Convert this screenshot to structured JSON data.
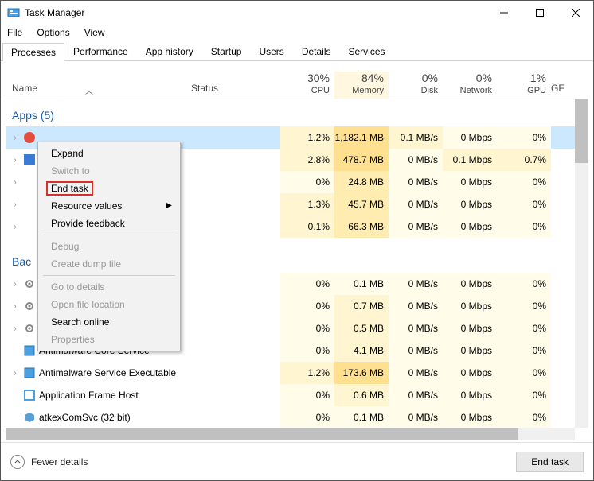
{
  "title": "Task Manager",
  "menubar": [
    "File",
    "Options",
    "View"
  ],
  "tabs": [
    "Processes",
    "Performance",
    "App history",
    "Startup",
    "Users",
    "Details",
    "Services"
  ],
  "active_tab": 0,
  "columns": {
    "name": "Name",
    "status": "Status",
    "metrics": [
      {
        "pct": "30%",
        "label": "CPU"
      },
      {
        "pct": "84%",
        "label": "Memory"
      },
      {
        "pct": "0%",
        "label": "Disk"
      },
      {
        "pct": "0%",
        "label": "Network"
      },
      {
        "pct": "1%",
        "label": "GPU"
      }
    ],
    "last": "GF"
  },
  "sections": [
    {
      "title": "Apps (5)"
    },
    {
      "title": "Bac"
    }
  ],
  "rows": [
    {
      "selected": true,
      "expander": true,
      "icon": "red",
      "name": "",
      "cells": [
        "1.2%",
        "1,182.1 MB",
        "0.1 MB/s",
        "0 Mbps",
        "0%"
      ],
      "shades": [
        1,
        3,
        1,
        0,
        0
      ]
    },
    {
      "expander": true,
      "icon": "blue",
      "name": "",
      "cells": [
        "2.8%",
        "478.7 MB",
        "0 MB/s",
        "0.1 Mbps",
        "0.7%"
      ],
      "shades": [
        1,
        3,
        0,
        1,
        1
      ]
    },
    {
      "expander": true,
      "icon": "none",
      "name": "",
      "cells": [
        "0%",
        "24.8 MB",
        "0 MB/s",
        "0 Mbps",
        "0%"
      ],
      "shades": [
        0,
        2,
        0,
        0,
        0
      ]
    },
    {
      "expander": true,
      "icon": "none",
      "name": "",
      "cells": [
        "1.3%",
        "45.7 MB",
        "0 MB/s",
        "0 Mbps",
        "0%"
      ],
      "shades": [
        1,
        2,
        0,
        0,
        0
      ]
    },
    {
      "expander": true,
      "icon": "none",
      "name": "",
      "cells": [
        "0.1%",
        "66.3 MB",
        "0 MB/s",
        "0 Mbps",
        "0%"
      ],
      "shades": [
        1,
        2,
        0,
        0,
        0
      ]
    }
  ],
  "rows2": [
    {
      "expander": true,
      "icon": "gear",
      "name": "",
      "cells": [
        "0%",
        "0.1 MB",
        "0 MB/s",
        "0 Mbps",
        "0%"
      ],
      "shades": [
        0,
        0,
        0,
        0,
        0
      ]
    },
    {
      "expander": true,
      "icon": "gear",
      "name": "",
      "cells": [
        "0%",
        "0.7 MB",
        "0 MB/s",
        "0 Mbps",
        "0%"
      ],
      "shades": [
        0,
        1,
        0,
        0,
        0
      ]
    },
    {
      "expander": true,
      "icon": "gear",
      "name": "",
      "cells": [
        "0%",
        "0.5 MB",
        "0 MB/s",
        "0 Mbps",
        "0%"
      ],
      "shades": [
        0,
        1,
        0,
        0,
        0
      ]
    },
    {
      "expander": false,
      "icon": "shield",
      "name": "Antimalware Core Service",
      "cells": [
        "0%",
        "4.1 MB",
        "0 MB/s",
        "0 Mbps",
        "0%"
      ],
      "shades": [
        0,
        1,
        0,
        0,
        0
      ]
    },
    {
      "expander": true,
      "icon": "shield",
      "name": "Antimalware Service Executable",
      "cells": [
        "1.2%",
        "173.6 MB",
        "0 MB/s",
        "0 Mbps",
        "0%"
      ],
      "shades": [
        1,
        3,
        0,
        0,
        0
      ]
    },
    {
      "expander": false,
      "icon": "app",
      "name": "Application Frame Host",
      "cells": [
        "0%",
        "0.6 MB",
        "0 MB/s",
        "0 Mbps",
        "0%"
      ],
      "shades": [
        0,
        1,
        0,
        0,
        0
      ]
    },
    {
      "expander": false,
      "icon": "cube",
      "name": "atkexComSvc (32 bit)",
      "cells": [
        "0%",
        "0.1 MB",
        "0 MB/s",
        "0 Mbps",
        "0%"
      ],
      "shades": [
        0,
        0,
        0,
        0,
        0
      ]
    }
  ],
  "context_menu": [
    {
      "label": "Expand",
      "enabled": true
    },
    {
      "label": "Switch to",
      "enabled": false
    },
    {
      "label": "End task",
      "enabled": true,
      "highlighted": true
    },
    {
      "label": "Resource values",
      "enabled": true,
      "submenu": true
    },
    {
      "label": "Provide feedback",
      "enabled": true
    },
    {
      "sep": true
    },
    {
      "label": "Debug",
      "enabled": false
    },
    {
      "label": "Create dump file",
      "enabled": false
    },
    {
      "sep": true
    },
    {
      "label": "Go to details",
      "enabled": false
    },
    {
      "label": "Open file location",
      "enabled": false
    },
    {
      "label": "Search online",
      "enabled": true
    },
    {
      "label": "Properties",
      "enabled": false
    }
  ],
  "footer": {
    "fewer": "Fewer details",
    "end_task": "End task"
  }
}
